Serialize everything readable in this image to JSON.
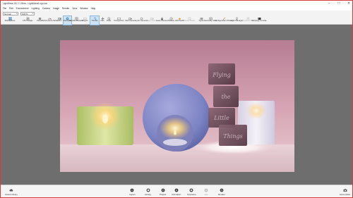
{
  "window": {
    "title": "LightWave 3D 2.1 Beta - LightWaveLogo.lwo",
    "controls": [
      "–",
      "□",
      "✕"
    ]
  },
  "menu": [
    "File",
    "Edit",
    "Environment",
    "Lighting",
    "Camera",
    "Image",
    "Render",
    "View",
    "Window",
    "Help"
  ],
  "toolbar": {
    "mode_select": "Normal",
    "zoom_select": "100 %",
    "tools": [
      {
        "label": "Workspaces",
        "icon": "workspaces-icon"
      },
      {
        "label": "CPU Usage",
        "icon": "cpu-icon"
      },
      {
        "label": "Pause",
        "icon": "pause-icon"
      },
      {
        "label": "Performance Mode",
        "icon": "performance-icon"
      },
      {
        "label": "GPU",
        "icon": "gpu-icon"
      },
      {
        "label": "Denoiser",
        "icon": "denoiser-icon"
      },
      {
        "label": "Render Buckets",
        "icon": "buckets-icon"
      },
      {
        "label": "Region",
        "icon": "region-icon"
      },
      {
        "label": "Tumble",
        "icon": "tumble-icon"
      },
      {
        "label": "Pan",
        "icon": "pan-icon"
      },
      {
        "label": "Dolly",
        "icon": "dolly-icon"
      },
      {
        "label": "Perspective",
        "icon": "perspective-icon"
      },
      {
        "label": "Add Camera",
        "icon": "add-camera-icon"
      },
      {
        "label": "Cycle Cameras",
        "icon": "cycle-cameras-icon"
      },
      {
        "label": "Insert Camera",
        "icon": "insert-camera-icon"
      },
      {
        "label": "Lock Camera",
        "icon": "lock-camera-icon"
      },
      {
        "label": "Radius",
        "icon": "radius-icon"
      },
      {
        "label": "Add Studio",
        "icon": "add-studio-icon"
      },
      {
        "label": "Create Studio",
        "icon": "create-studio-icon"
      },
      {
        "label": "Types",
        "icon": "types-icon"
      },
      {
        "label": "Geometry View",
        "icon": "geometry-view-icon"
      },
      {
        "label": "Configuration Wizard",
        "icon": "wizard-icon"
      },
      {
        "label": "Light Manager",
        "icon": "light-manager-icon"
      },
      {
        "label": "Render to Disk",
        "icon": "render-disk-icon"
      },
      {
        "label": "Scripting Console",
        "icon": "console-icon"
      }
    ]
  },
  "statusbar": {
    "left": {
      "label": "Cloud Library",
      "icon": "cloud-library-icon"
    },
    "center": [
      {
        "label": "Import",
        "icon": "import-icon"
      },
      {
        "label": "Library",
        "icon": "library-icon"
      },
      {
        "label": "Project",
        "icon": "project-icon"
      },
      {
        "label": "Animation",
        "icon": "animation-icon"
      },
      {
        "label": "Keyframe",
        "icon": "keyframe-icon"
      },
      {
        "label": "Net",
        "icon": "net-icon"
      },
      {
        "label": "Render",
        "icon": "render-icon"
      }
    ],
    "right": {
      "label": "Screenshot",
      "icon": "screenshot-icon"
    }
  },
  "scene": {
    "cube_words": [
      "Flying",
      "the",
      "Little",
      "Things"
    ],
    "colors": {
      "wall": "#cf9aaa",
      "floor": "#ead8dc",
      "candle_left": "#c7d78a",
      "sphere": "#8b8fc9",
      "candle_right": "#e4e2ee",
      "cube": "#6d4b58"
    }
  }
}
